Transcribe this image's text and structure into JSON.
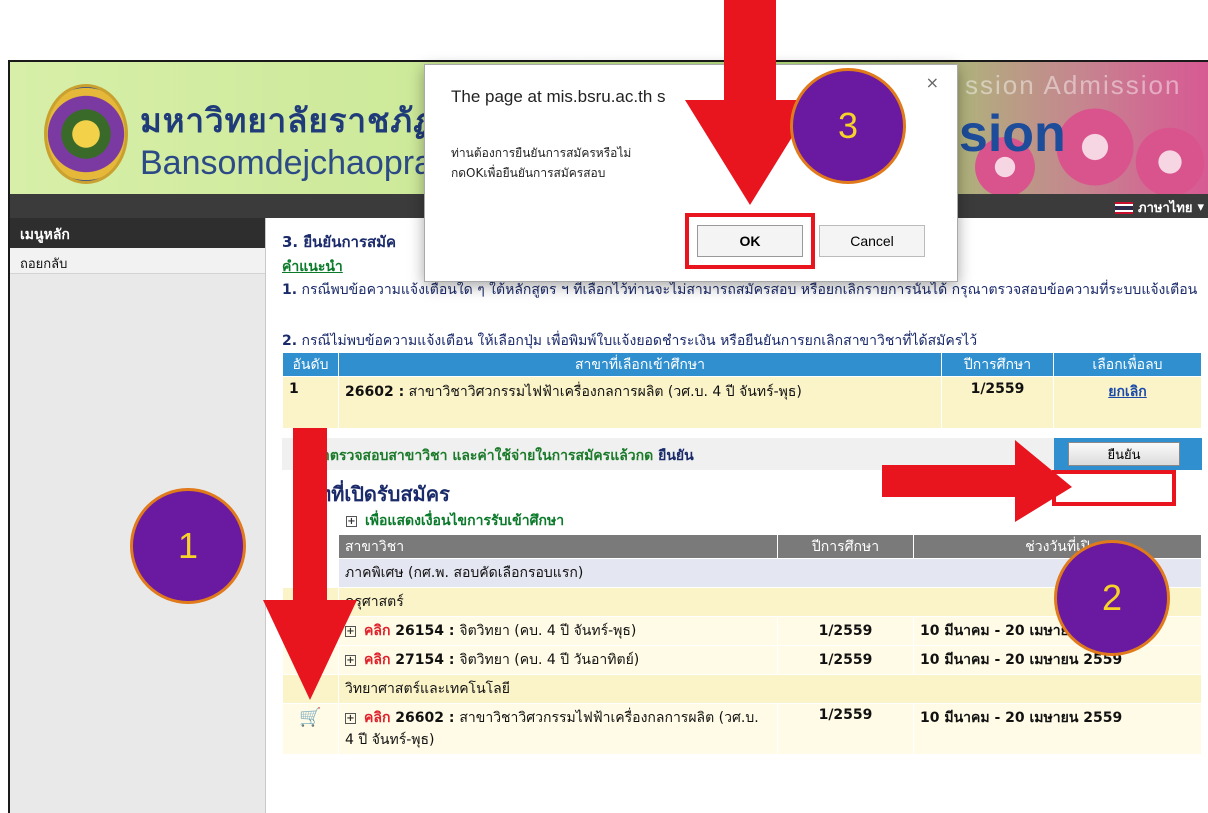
{
  "header": {
    "university_th": "มหาวิทยาลัยราชภัฏบ้าน",
    "university_en": "Bansomdejchaopraya",
    "admission_text": "ssion",
    "admission_ghost": "ssion Admission",
    "language": "ภาษาไทย"
  },
  "sidebar": {
    "title": "เมนูหลัก",
    "items": [
      {
        "label": "ถอยกลับ"
      }
    ]
  },
  "main": {
    "step_title": "3. ยืนยันการสมัค",
    "advice_label": "คำแนะนำ",
    "note1_num": "1.",
    "note1_text": "กรณีพบข้อความแจ้งเตือนใด ๆ ใต้หลักสูตร ฯ ที่เลือกไว้ท่านจะไม่สามารถสมัครสอบ หรือยกเลิกรายการนั้นได้ กรุณาตรวจสอบข้อความที่ระบบแจ้งเตือน",
    "note2_num": "2.",
    "note2_text": "กรณีไม่พบข้อความแจ้งเตือน ให้เลือกปุ่ม เพื่อพิมพ์ใบแจ้งยอดชำระเงิน หรือยืนยันการยกเลิกสาขาวิชาที่ได้สมัครไว้"
  },
  "selected_table": {
    "headers": [
      "อันดับ",
      "สาขาที่เลือกเข้าศึกษา",
      "ปีการศึกษา",
      "เลือกเพื่อลบ"
    ],
    "rows": [
      {
        "rank": "1",
        "code": "26602 :",
        "program": "สาขาวิชาวิศวกรรมไฟฟ้าเครื่องกลการผลิต (วศ.บ. 4 ปี จันทร์-พุธ)",
        "year": "1/2559",
        "action": "ยกเลิก"
      }
    ]
  },
  "confirm": {
    "text": "าตรวจสอบสาขาวิชา และค่าใช้จ่ายในการสมัครแล้วกด",
    "text_bold": "ยืนยัน",
    "button_label": "ยืนยัน"
  },
  "open_section": {
    "title": "เภทที่เปิดรับสมัคร",
    "condition_link": "เพื่อแสดงเงื่อนไขการรับเข้าศึกษา",
    "headers": [
      "สาขาวิชา",
      "ปีการศึกษา",
      "ช่วงวันที่เปิ"
    ],
    "category": "ภาคพิเศษ (กศ.พ. สอบคัดเลือกรอบแรก)",
    "groups": [
      {
        "name": "ครุศาสตร์",
        "items": [
          {
            "click": "คลิก",
            "code": "26154 :",
            "name": "จิตวิทยา (คบ. 4 ปี จันทร์-พุธ)",
            "year": "1/2559",
            "period": "10 มีนาคม - 20 เมษายน 2559"
          },
          {
            "click": "คลิก",
            "code": "27154 :",
            "name": "จิตวิทยา (คบ. 4 ปี วันอาทิตย์)",
            "year": "1/2559",
            "period": "10 มีนาคม - 20 เมษายน 2559"
          }
        ]
      },
      {
        "name": "วิทยาศาสตร์และเทคโนโลยี",
        "items": [
          {
            "click": "คลิก",
            "code": "26602 :",
            "name": "สาขาวิชาวิศวกรรมไฟฟ้าเครื่องกลการผลิต (วศ.บ. 4 ปี จันทร์-พุธ)",
            "year": "1/2559",
            "period": "10 มีนาคม - 20 เมษายน 2559"
          }
        ]
      }
    ]
  },
  "dialog": {
    "title": "The page at mis.bsru.ac.th s",
    "message_line1": "ท่านต้องการยืนยันการสมัครหรือไม่",
    "message_line2": "กดOKเพื่อยืนยันการสมัครสอบ",
    "ok_label": "OK",
    "cancel_label": "Cancel",
    "close": "×"
  },
  "annotations": {
    "step1": "1",
    "step2": "2",
    "step3": "3",
    "arrow_color": "#e8141e",
    "circle_color": "#6a1aa0"
  }
}
